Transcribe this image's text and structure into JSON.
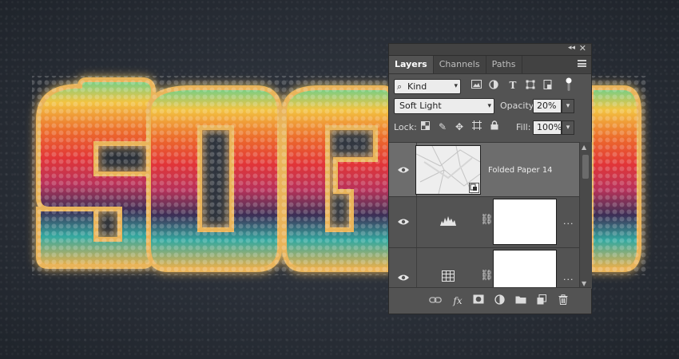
{
  "panel": {
    "tabs": [
      {
        "label": "Layers",
        "active": true
      },
      {
        "label": "Channels",
        "active": false
      },
      {
        "label": "Paths",
        "active": false
      }
    ],
    "filter": {
      "label": "Kind"
    },
    "blend_mode": {
      "value": "Soft Light"
    },
    "opacity": {
      "label": "Opacity:",
      "value": "20%"
    },
    "lock": {
      "label": "Lock:"
    },
    "fill": {
      "label": "Fill:",
      "value": "100%"
    },
    "layers": [
      {
        "name": "Folded Paper 14",
        "type": "smart-object",
        "visible": true,
        "selected": true
      },
      {
        "name": "",
        "type": "levels-adjustment",
        "visible": true,
        "selected": false,
        "more": "..."
      },
      {
        "name": "",
        "type": "table-adjustment",
        "visible": true,
        "selected": false,
        "more": "..."
      }
    ],
    "accent": "#535353"
  },
  "artwork": {
    "text": "SOGO",
    "colors": [
      "#f5c242",
      "#e8652b",
      "#d92e3a",
      "#3c2e55",
      "#2bb3a6",
      "#7fd17a"
    ]
  }
}
